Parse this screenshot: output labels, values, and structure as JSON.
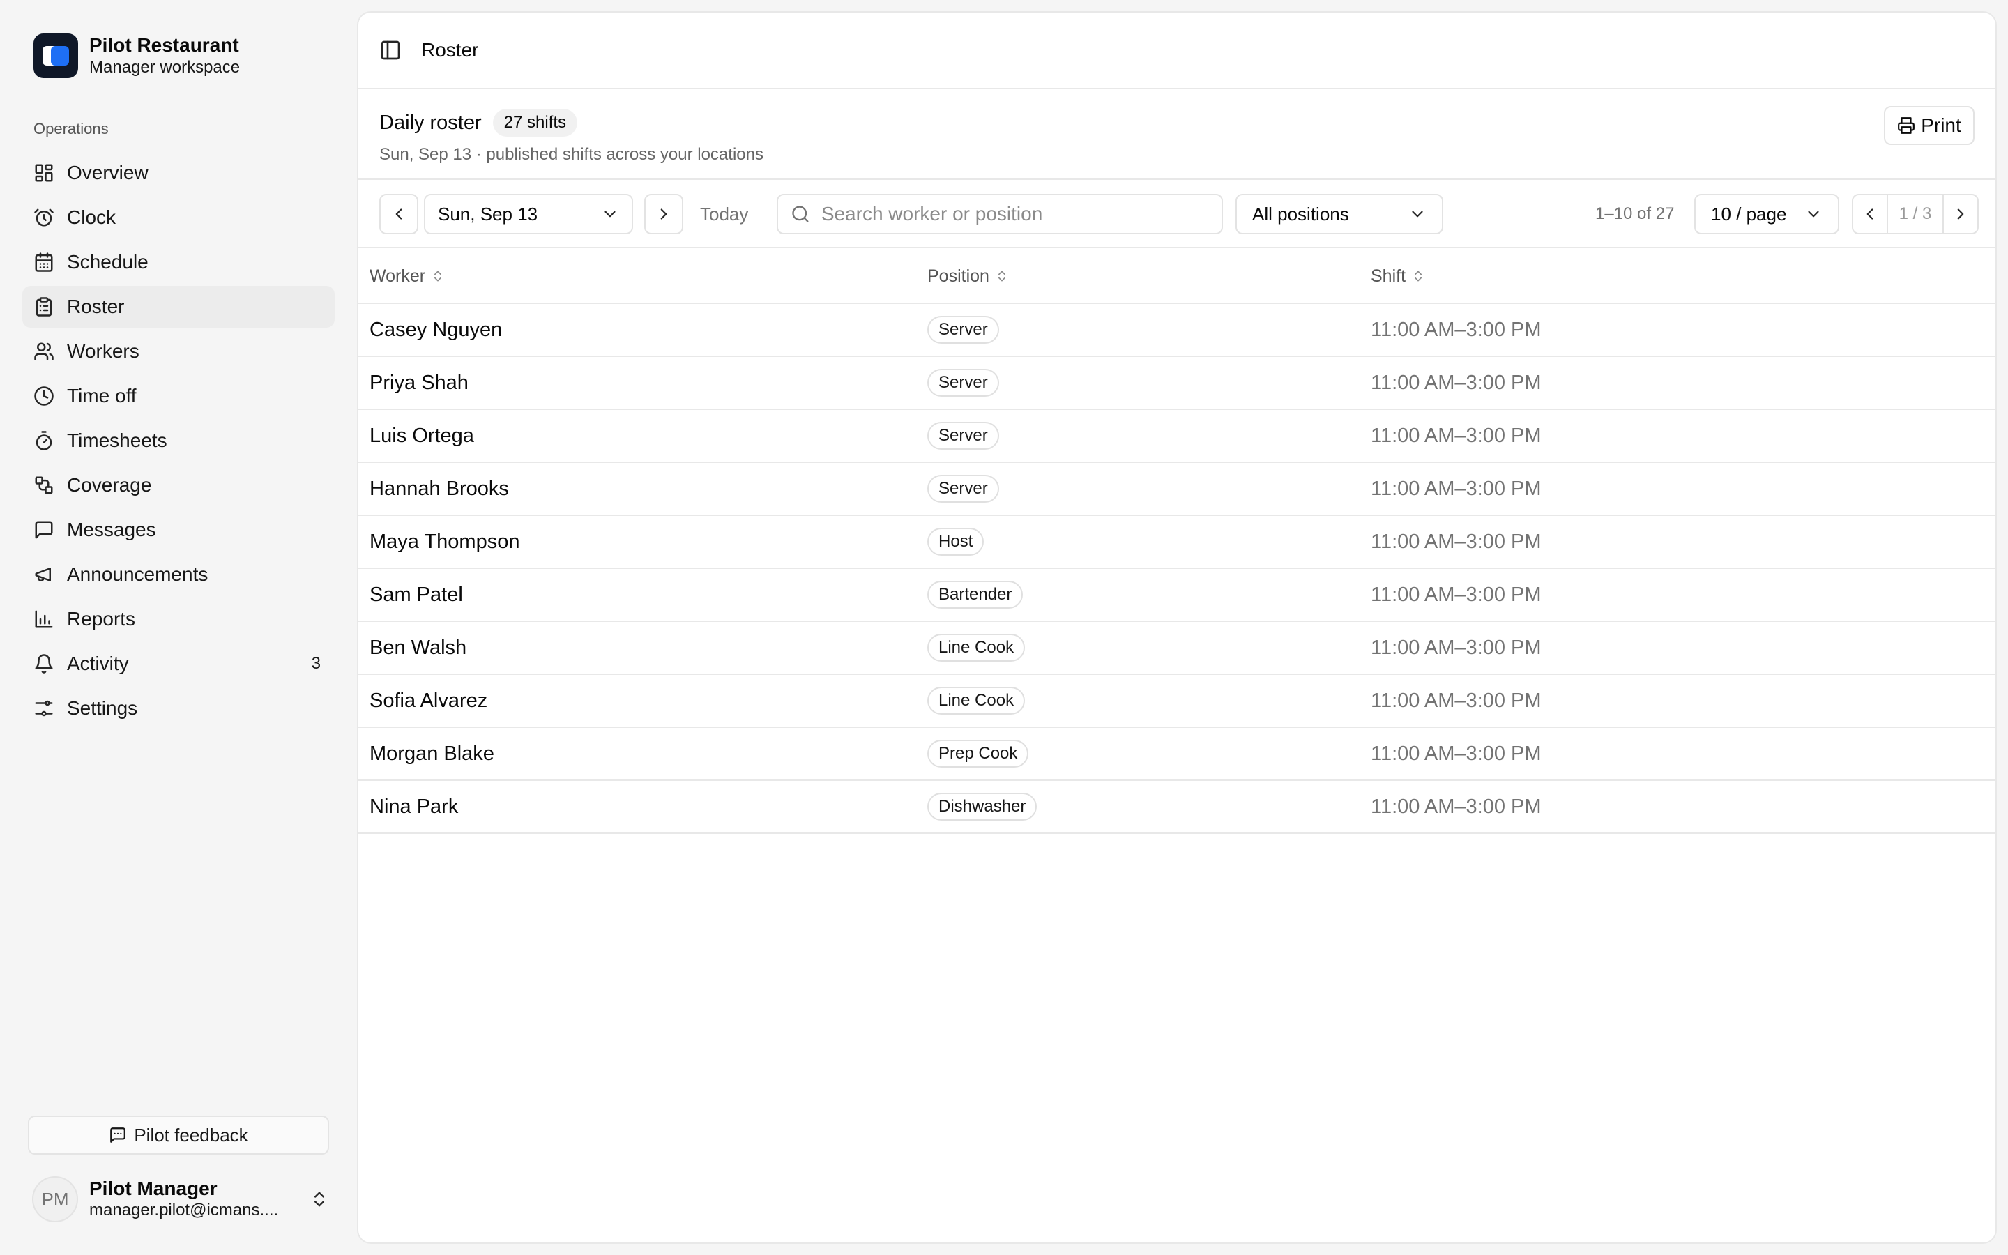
{
  "brand": {
    "name": "Pilot Restaurant",
    "subtitle": "Manager workspace"
  },
  "sidebar": {
    "group_label": "Operations",
    "items": [
      {
        "label": "Overview",
        "icon": "layout-dashboard-icon"
      },
      {
        "label": "Clock",
        "icon": "alarm-clock-icon"
      },
      {
        "label": "Schedule",
        "icon": "calendar-icon"
      },
      {
        "label": "Roster",
        "icon": "clipboard-list-icon",
        "active": true
      },
      {
        "label": "Workers",
        "icon": "users-icon"
      },
      {
        "label": "Time off",
        "icon": "clock-icon"
      },
      {
        "label": "Timesheets",
        "icon": "timer-icon"
      },
      {
        "label": "Coverage",
        "icon": "git-compare-icon"
      },
      {
        "label": "Messages",
        "icon": "message-square-icon"
      },
      {
        "label": "Announcements",
        "icon": "megaphone-icon"
      },
      {
        "label": "Reports",
        "icon": "bar-chart-icon"
      },
      {
        "label": "Activity",
        "icon": "bell-icon",
        "badge": "3"
      },
      {
        "label": "Settings",
        "icon": "sliders-icon"
      }
    ],
    "feedback_label": "Pilot feedback",
    "user": {
      "initials": "PM",
      "name": "Pilot Manager",
      "email": "manager.pilot@icmans...."
    }
  },
  "topbar": {
    "title": "Roster"
  },
  "header": {
    "title": "Daily roster",
    "shift_count": "27 shifts",
    "subtitle": "Sun, Sep 13 · published shifts across your locations",
    "print_label": "Print"
  },
  "toolbar": {
    "date": "Sun, Sep 13",
    "today_label": "Today",
    "search_placeholder": "Search worker or position",
    "search_value": "",
    "position_filter": "All positions",
    "range_text": "1–10 of 27",
    "page_size": "10 / page",
    "page_indicator": "1 / 3"
  },
  "table": {
    "columns": [
      "Worker",
      "Position",
      "Shift"
    ],
    "rows": [
      {
        "worker": "Casey Nguyen",
        "position": "Server",
        "shift": "11:00 AM–3:00 PM"
      },
      {
        "worker": "Priya Shah",
        "position": "Server",
        "shift": "11:00 AM–3:00 PM"
      },
      {
        "worker": "Luis Ortega",
        "position": "Server",
        "shift": "11:00 AM–3:00 PM"
      },
      {
        "worker": "Hannah Brooks",
        "position": "Server",
        "shift": "11:00 AM–3:00 PM"
      },
      {
        "worker": "Maya Thompson",
        "position": "Host",
        "shift": "11:00 AM–3:00 PM"
      },
      {
        "worker": "Sam Patel",
        "position": "Bartender",
        "shift": "11:00 AM–3:00 PM"
      },
      {
        "worker": "Ben Walsh",
        "position": "Line Cook",
        "shift": "11:00 AM–3:00 PM"
      },
      {
        "worker": "Sofia Alvarez",
        "position": "Line Cook",
        "shift": "11:00 AM–3:00 PM"
      },
      {
        "worker": "Morgan Blake",
        "position": "Prep Cook",
        "shift": "11:00 AM–3:00 PM"
      },
      {
        "worker": "Nina Park",
        "position": "Dishwasher",
        "shift": "11:00 AM–3:00 PM"
      }
    ]
  },
  "colors": {
    "brand_blue": "#1e6ff5",
    "logo_dark": "#101828",
    "active_nav": "#ececec",
    "muted_text": "#737373"
  }
}
